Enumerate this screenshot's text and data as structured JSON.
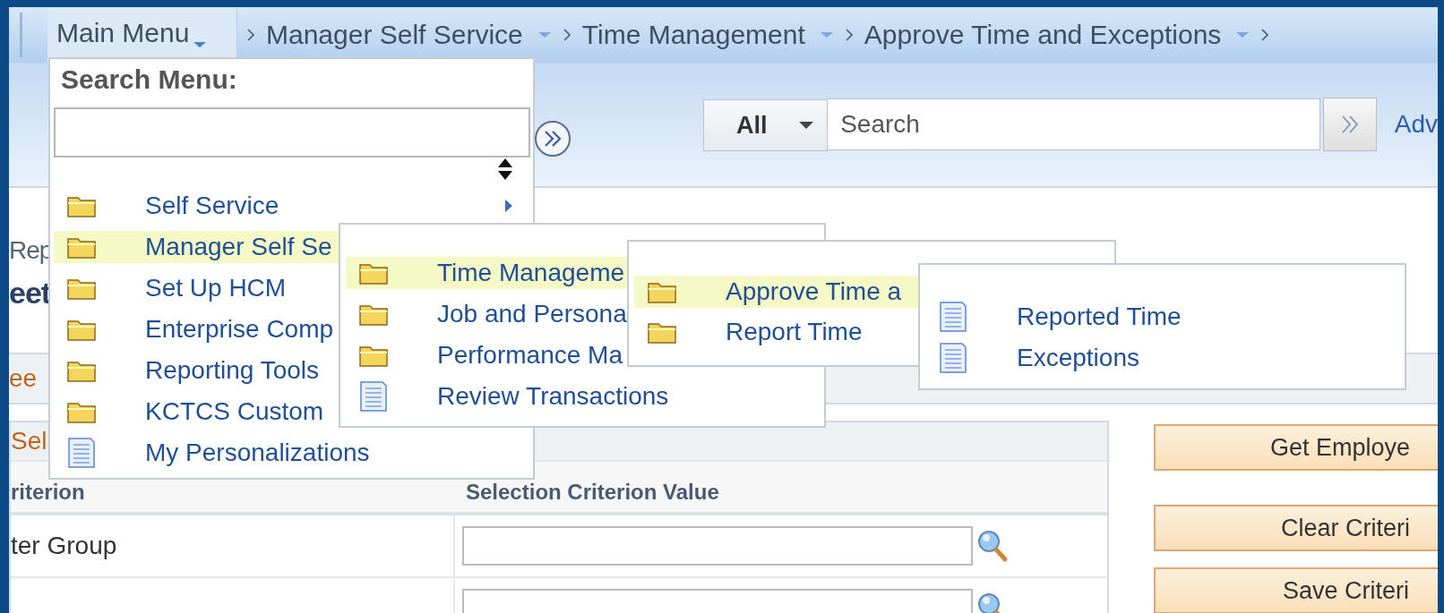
{
  "breadcrumb": {
    "main_menu": "Main Menu",
    "crumbs": [
      {
        "label": "Manager Self Service"
      },
      {
        "label": "Time Management"
      },
      {
        "label": "Approve Time and Exceptions"
      }
    ]
  },
  "search": {
    "scope": "All",
    "placeholder": "Search",
    "advanced_link": "Adv"
  },
  "page": {
    "heading": "Rep",
    "title": "eet",
    "tab": "ee",
    "group_title": "Sel",
    "table": {
      "columns": [
        "riterion",
        "Selection Criterion Value"
      ],
      "rows": [
        {
          "kind": "lookup",
          "label": "ter Group"
        },
        {
          "kind": "lookup"
        }
      ]
    },
    "buttons": [
      "Get Employe",
      "Clear Criteri",
      "Save Criteri"
    ]
  },
  "search_menu": {
    "title": "Search Menu:",
    "items": [
      {
        "kind": "folder",
        "label": "Self Service",
        "selected": false,
        "submenu_arrow": true
      },
      {
        "kind": "folder",
        "label": "Manager Self Se",
        "selected": true,
        "submenu_arrow": false
      },
      {
        "kind": "folder",
        "label": "Set Up HCM",
        "selected": false,
        "submenu_arrow": false
      },
      {
        "kind": "folder",
        "label": "Enterprise Comp",
        "selected": false,
        "submenu_arrow": false
      },
      {
        "kind": "folder",
        "label": "Reporting Tools",
        "selected": false,
        "submenu_arrow": false
      },
      {
        "kind": "folder",
        "label": "KCTCS Custom",
        "selected": false,
        "submenu_arrow": false
      },
      {
        "kind": "page",
        "label": "My Personalizations",
        "selected": false,
        "submenu_arrow": false
      }
    ]
  },
  "submenus": [
    {
      "items": [
        {
          "kind": "folder",
          "label": "Time Manageme",
          "selected": true
        },
        {
          "kind": "folder",
          "label": "Job and Persona",
          "selected": false
        },
        {
          "kind": "folder",
          "label": "Performance Ma",
          "selected": false
        },
        {
          "kind": "page",
          "label": "Review Transactions",
          "selected": false
        }
      ]
    },
    {
      "items": [
        {
          "kind": "folder",
          "label": "Approve Time a",
          "selected": true
        },
        {
          "kind": "folder",
          "label": "Report Time",
          "selected": false
        }
      ]
    },
    {
      "items": [
        {
          "kind": "page",
          "label": "Reported Time",
          "selected": false
        },
        {
          "kind": "page",
          "label": "Exceptions",
          "selected": false
        }
      ]
    }
  ]
}
